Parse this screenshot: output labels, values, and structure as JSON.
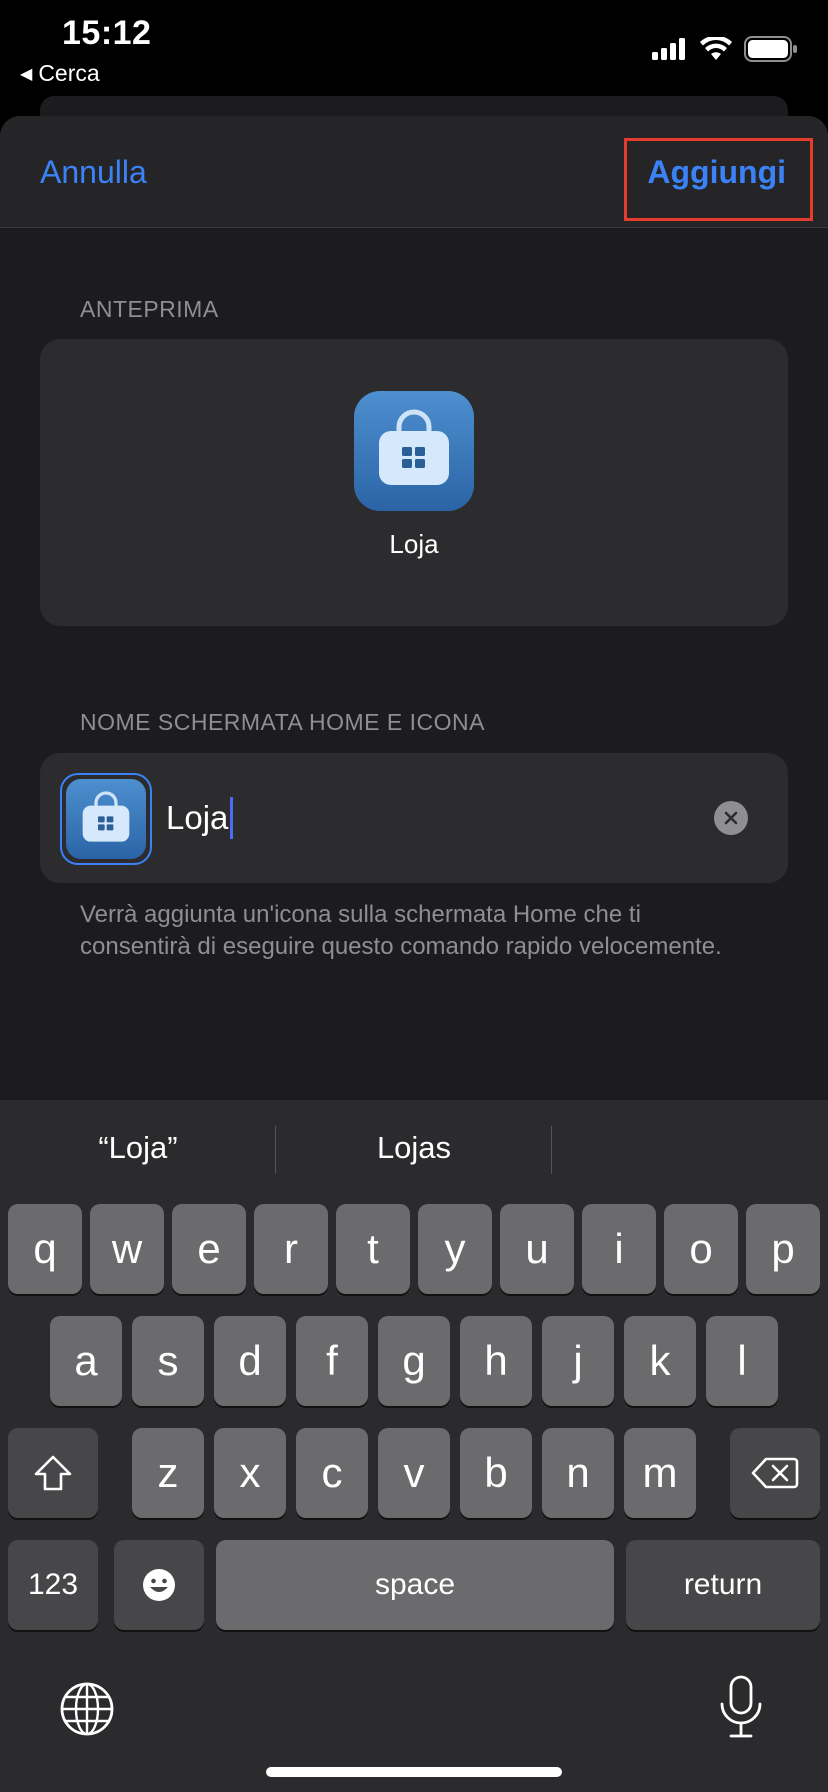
{
  "status_bar": {
    "time": "15:12",
    "back_app": "Cerca"
  },
  "nav": {
    "cancel_label": "Annulla",
    "add_label": "Aggiungi"
  },
  "preview": {
    "section_label": "ANTEPRIMA",
    "app_name": "Loja",
    "icon": "shopping-bag-icon"
  },
  "name_section": {
    "section_label": "NOME SCHERMATA HOME E ICONA",
    "input_value": "Loja",
    "help_text": "Verrà aggiunta un'icona sulla schermata Home che ti consentirà di eseguire questo comando rapido velocemente."
  },
  "keyboard": {
    "suggestions": [
      "“Loja”",
      "Lojas",
      ""
    ],
    "row1": [
      "q",
      "w",
      "e",
      "r",
      "t",
      "y",
      "u",
      "i",
      "o",
      "p"
    ],
    "row2": [
      "a",
      "s",
      "d",
      "f",
      "g",
      "h",
      "j",
      "k",
      "l"
    ],
    "row3": [
      "z",
      "x",
      "c",
      "v",
      "b",
      "n",
      "m"
    ],
    "numbers_label": "123",
    "space_label": "space",
    "return_label": "return"
  },
  "colors": {
    "accent": "#3b82f6",
    "highlight_box": "#e43d2f"
  }
}
